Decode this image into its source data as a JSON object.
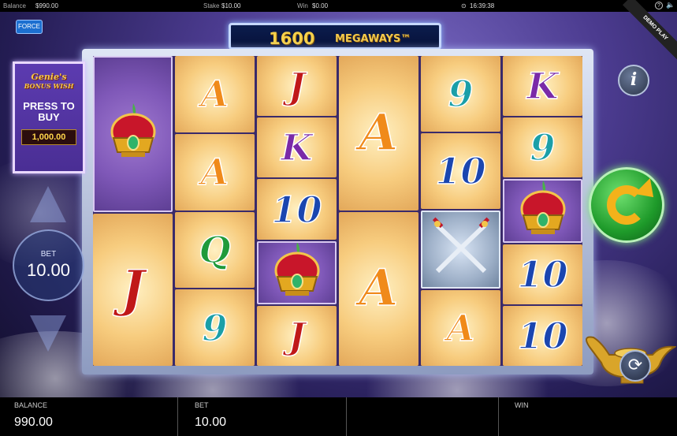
{
  "top_bar": {
    "balance_label": "Balance",
    "balance_value": "$990.00",
    "stake_label": "Stake",
    "stake_value": "$10.00",
    "win_label": "Win",
    "win_value": "$0.00",
    "clock": "16:39:38",
    "icons": [
      "help-icon",
      "sound-icon"
    ]
  },
  "force_button": "FORCE",
  "demo_ribbon": "DEMO PLAY",
  "logo": {
    "number": "1600",
    "text": "MEGAWAYS™"
  },
  "bonus_panel": {
    "title_line1": "Genie's",
    "title_line2": "BONUS WISH",
    "press_line1": "PRESS TO",
    "press_line2": "BUY",
    "price": "1,000.00"
  },
  "bet_control": {
    "label": "BET",
    "value": "10.00"
  },
  "info_button": "i",
  "reels": [
    [
      "crown",
      "J"
    ],
    [
      "A",
      "A",
      "Q",
      "9"
    ],
    [
      "J",
      "K",
      "10",
      "crown",
      "J"
    ],
    [
      "A",
      "A"
    ],
    [
      "9",
      "10",
      "swords",
      "A"
    ],
    [
      "K",
      "9",
      "crown",
      "10",
      "10"
    ]
  ],
  "symbol_icons": {
    "crown": "crown-icon",
    "swords": "crossed-swords-icon"
  },
  "bottom_bar": {
    "balance_label": "BALANCE",
    "balance_value": "990.00",
    "bet_label": "BET",
    "bet_value": "10.00",
    "win_label": "WIN",
    "win_value": ""
  }
}
